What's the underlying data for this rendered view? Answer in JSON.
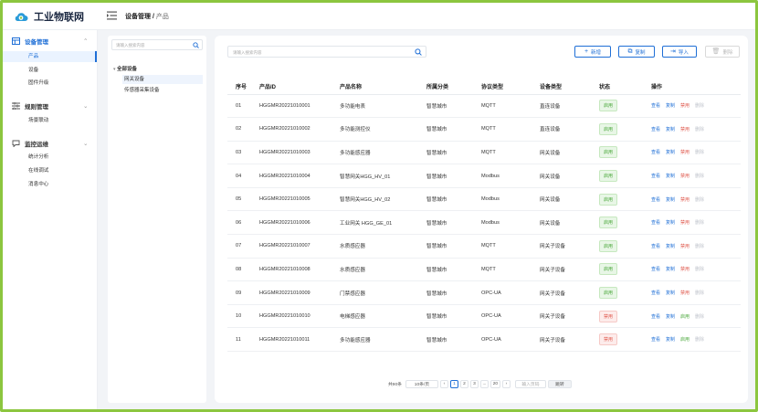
{
  "app": {
    "title": "工业物联网",
    "brand_color": "#2a9bd8",
    "accent": "#1f6fd6"
  },
  "breadcrumb": {
    "parent": "设备管理",
    "separator": "/",
    "current": "产品"
  },
  "sidebar": {
    "groups": [
      {
        "label": "设备管理",
        "icon": "device-icon",
        "active": true,
        "items": [
          {
            "label": "产品",
            "active": true
          },
          {
            "label": "设备",
            "active": false
          },
          {
            "label": "固件升级",
            "active": false
          }
        ]
      },
      {
        "label": "规则管理",
        "icon": "rule-icon",
        "active": false,
        "items": [
          {
            "label": "场景联动",
            "active": false
          }
        ]
      },
      {
        "label": "监控运维",
        "icon": "monitor-icon",
        "active": false,
        "items": [
          {
            "label": "统计分析",
            "active": false
          },
          {
            "label": "在线调试",
            "active": false
          },
          {
            "label": "消息中心",
            "active": false
          }
        ]
      }
    ]
  },
  "tree": {
    "search_placeholder": "请输入搜索内容",
    "nodes": [
      {
        "label": "全部设备",
        "level": 0
      },
      {
        "label": "网关设备",
        "level": 1
      },
      {
        "label": "传感器采集设备",
        "level": 1
      }
    ]
  },
  "toolbar": {
    "search_placeholder": "请输入搜索内容",
    "add": "新增",
    "copy": "复制",
    "import": "导入",
    "delete": "删除"
  },
  "table": {
    "headers": [
      "序号",
      "产品ID",
      "产品名称",
      "所属分类",
      "协议类型",
      "设备类型",
      "状态",
      "操作"
    ],
    "rows": [
      {
        "no": "01",
        "id": "HGGMR20221010001",
        "name": "多功能电表",
        "cat": "智慧城市",
        "proto": "MQTT",
        "type": "直连设备",
        "status": "启用",
        "status_on": true
      },
      {
        "no": "02",
        "id": "HGGMR20221010002",
        "name": "多功能测控仪",
        "cat": "智慧城市",
        "proto": "MQTT",
        "type": "直连设备",
        "status": "启用",
        "status_on": true
      },
      {
        "no": "03",
        "id": "HGGMR20221010003",
        "name": "多功能感应器",
        "cat": "智慧城市",
        "proto": "MQTT",
        "type": "网关设备",
        "status": "启用",
        "status_on": true
      },
      {
        "no": "04",
        "id": "HGGMR20221010004",
        "name": "智慧网关HGG_HV_01",
        "cat": "智慧城市",
        "proto": "Modbus",
        "type": "网关设备",
        "status": "启用",
        "status_on": true
      },
      {
        "no": "05",
        "id": "HGGMR20221010005",
        "name": "智慧网关HGG_HV_02",
        "cat": "智慧城市",
        "proto": "Modbus",
        "type": "网关设备",
        "status": "启用",
        "status_on": true
      },
      {
        "no": "06",
        "id": "HGGMR20221010006",
        "name": "工业网关 HGG_GE_01",
        "cat": "智慧城市",
        "proto": "Modbus",
        "type": "网关设备",
        "status": "启用",
        "status_on": true
      },
      {
        "no": "07",
        "id": "HGGMR20221010007",
        "name": "水质感应器",
        "cat": "智慧城市",
        "proto": "MQTT",
        "type": "网关子设备",
        "status": "启用",
        "status_on": true
      },
      {
        "no": "08",
        "id": "HGGMR20221010008",
        "name": "水质感应器",
        "cat": "智慧城市",
        "proto": "MQTT",
        "type": "网关子设备",
        "status": "启用",
        "status_on": true
      },
      {
        "no": "09",
        "id": "HGGMR20221010009",
        "name": "门禁感应器",
        "cat": "智慧城市",
        "proto": "OPC-UA",
        "type": "网关子设备",
        "status": "启用",
        "status_on": true
      },
      {
        "no": "10",
        "id": "HGGMR20221010010",
        "name": "电梯感应器",
        "cat": "智慧城市",
        "proto": "OPC-UA",
        "type": "网关子设备",
        "status": "禁用",
        "status_on": false
      },
      {
        "no": "11",
        "id": "HGGMR20221010011",
        "name": "多功能感应器",
        "cat": "智慧城市",
        "proto": "OPC-UA",
        "type": "网关子设备",
        "status": "禁用",
        "status_on": false
      }
    ],
    "actions": {
      "view": "查看",
      "edit": "复制",
      "disable": "禁用",
      "enable": "启用",
      "delete": "删除"
    }
  },
  "pager": {
    "total": "共90条",
    "page_size": "10条/页",
    "pages": [
      "1",
      "2",
      "3",
      "...",
      "20"
    ],
    "current": "1",
    "goto_placeholder": "输入页码",
    "go": "跳转"
  }
}
